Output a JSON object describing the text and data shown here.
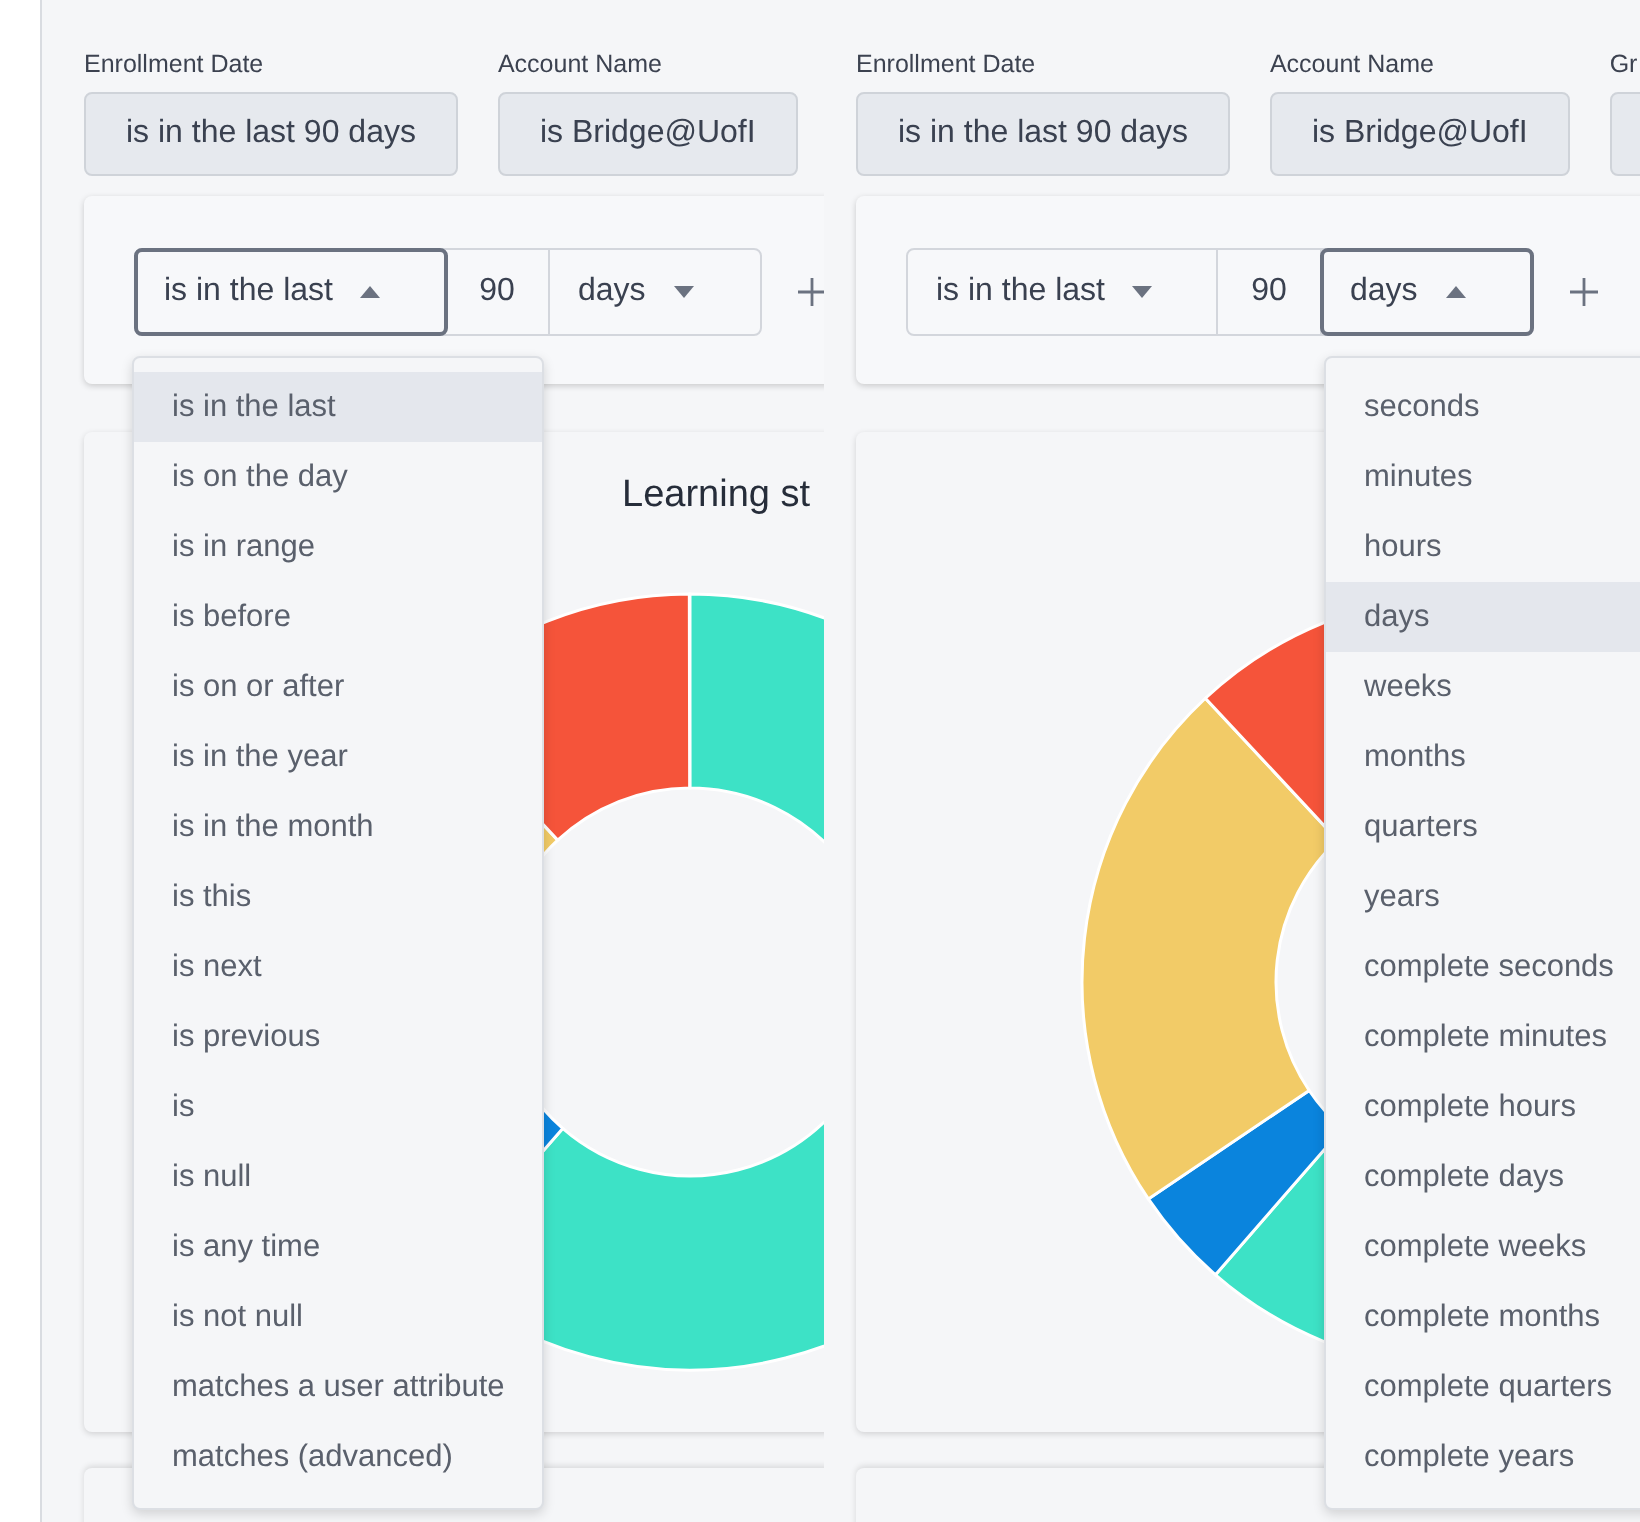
{
  "panels": [
    {
      "filters": [
        {
          "label": "Enrollment Date",
          "value": "is in the last 90 days"
        },
        {
          "label": "Account Name",
          "value": "is Bridge@UofI"
        }
      ],
      "editor": {
        "operator": {
          "text": "is in the last",
          "open": true
        },
        "number": "90",
        "unit": {
          "text": "days",
          "open": false
        }
      },
      "menu": {
        "items": [
          {
            "label": "is in the last",
            "selected": true
          },
          {
            "label": "is on the day",
            "selected": false
          },
          {
            "label": "is in range",
            "selected": false
          },
          {
            "label": "is before",
            "selected": false
          },
          {
            "label": "is on or after",
            "selected": false
          },
          {
            "label": "is in the year",
            "selected": false
          },
          {
            "label": "is in the month",
            "selected": false
          },
          {
            "label": "is this",
            "selected": false
          },
          {
            "label": "is next",
            "selected": false
          },
          {
            "label": "is previous",
            "selected": false
          },
          {
            "label": "is",
            "selected": false
          },
          {
            "label": "is null",
            "selected": false
          },
          {
            "label": "is any time",
            "selected": false
          },
          {
            "label": "is not null",
            "selected": false
          },
          {
            "label": "matches a user attribute",
            "selected": false
          },
          {
            "label": "matches (advanced)",
            "selected": false
          }
        ]
      },
      "chart": {
        "title": "Learning st"
      }
    },
    {
      "filters": [
        {
          "label": "Enrollment Date",
          "value": "is in the last 90 days"
        },
        {
          "label": "Account Name",
          "value": "is Bridge@UofI"
        },
        {
          "label": "Gr"
        }
      ],
      "editor": {
        "operator": {
          "text": "is in the last",
          "open": false
        },
        "number": "90",
        "unit": {
          "text": "days",
          "open": true
        }
      },
      "menu": {
        "items": [
          {
            "label": "seconds",
            "selected": false
          },
          {
            "label": "minutes",
            "selected": false
          },
          {
            "label": "hours",
            "selected": false
          },
          {
            "label": "days",
            "selected": true
          },
          {
            "label": "weeks",
            "selected": false
          },
          {
            "label": "months",
            "selected": false
          },
          {
            "label": "quarters",
            "selected": false
          },
          {
            "label": "years",
            "selected": false
          },
          {
            "label": "complete seconds",
            "selected": false
          },
          {
            "label": "complete minutes",
            "selected": false
          },
          {
            "label": "complete hours",
            "selected": false
          },
          {
            "label": "complete days",
            "selected": false
          },
          {
            "label": "complete weeks",
            "selected": false
          },
          {
            "label": "complete months",
            "selected": false
          },
          {
            "label": "complete quarters",
            "selected": false
          },
          {
            "label": "complete years",
            "selected": false
          }
        ]
      }
    }
  ]
}
